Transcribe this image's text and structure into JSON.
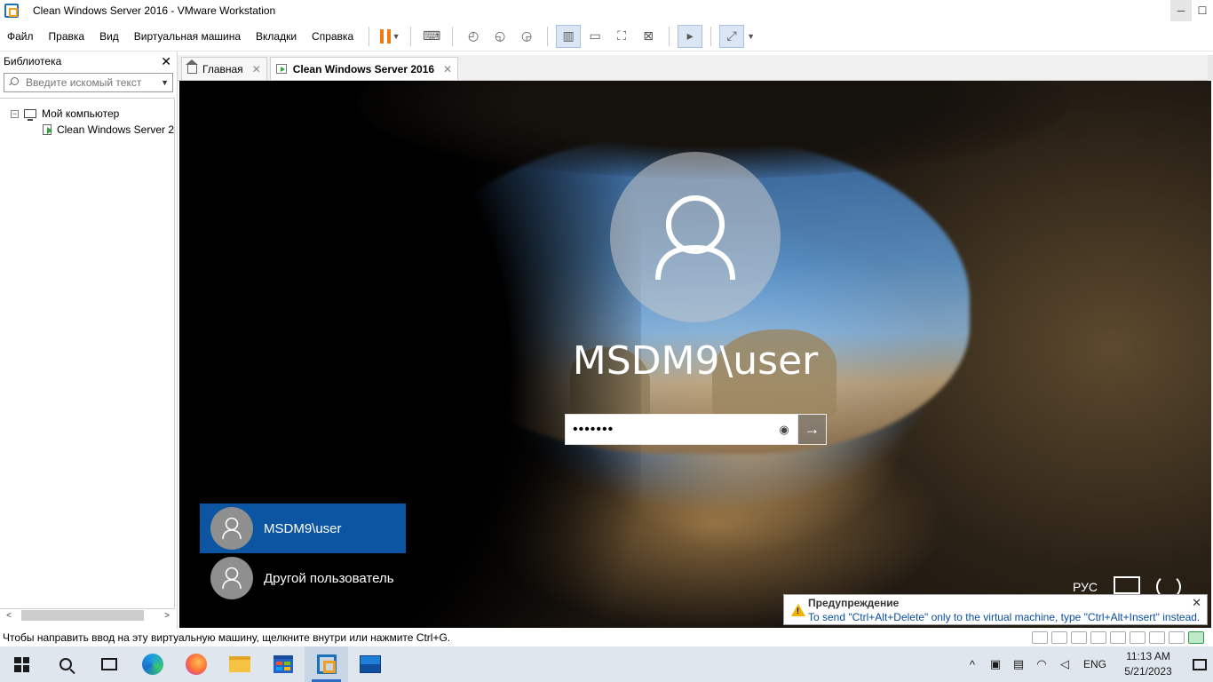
{
  "window": {
    "title": "Clean Windows Server 2016 - VMware Workstation",
    "controls": {
      "minimize": "─",
      "maximize": "☐"
    }
  },
  "menu": [
    "Файл",
    "Правка",
    "Вид",
    "Виртуальная машина",
    "Вкладки",
    "Справка"
  ],
  "toolbar": {
    "icons": [
      "pause-icon",
      "send-ctrl-alt-del-icon",
      "snapshot-icon",
      "revert-snapshot-icon",
      "snapshot-manager-icon",
      "library-view-icon",
      "thumbnail-view-icon",
      "full-screen-icon",
      "unity-icon",
      "console-icon",
      "stretch-icon"
    ]
  },
  "library": {
    "title": "Библиотека",
    "close": "✕",
    "search_placeholder": "Введите искомый текст",
    "tree": {
      "root": "Мой компьютер",
      "children": [
        "Clean Windows Server 2"
      ]
    }
  },
  "tabs": [
    {
      "label": "Главная",
      "active": false,
      "icon": "home-icon"
    },
    {
      "label": "Clean Windows Server 2016",
      "active": true,
      "icon": "vm-icon"
    }
  ],
  "tab_close": "✕",
  "login": {
    "user_name": "MSDM9\\user",
    "password_mask": "•••••••",
    "eye": "◉",
    "submit": "→",
    "users": [
      {
        "name": "MSDM9\\user",
        "selected": true
      },
      {
        "name": "Другой пользователь",
        "selected": false
      }
    ],
    "language": "РУС"
  },
  "warning": {
    "title": "Предупреждение",
    "text": "To send \"Ctrl+Alt+Delete\" only to the virtual machine, type \"Ctrl+Alt+Insert\" instead.",
    "close": "✕"
  },
  "statusbar": {
    "text": "Чтобы направить ввод на эту виртуальную машину, щелкните внутри или нажмите Ctrl+G."
  },
  "taskbar": {
    "apps": [
      "start-icon",
      "search-icon",
      "task-view-icon",
      "edge-icon",
      "firefox-icon",
      "file-explorer-icon",
      "store-icon",
      "vmware-icon",
      "photos-icon"
    ],
    "tray": {
      "chevron": "^",
      "language": "ENG",
      "time": "11:13 AM",
      "date": "5/21/2023"
    }
  },
  "colors": {
    "selected_user": "#0b55a2",
    "pause": "#f07a14",
    "warning_text": "#0a4ea0"
  }
}
